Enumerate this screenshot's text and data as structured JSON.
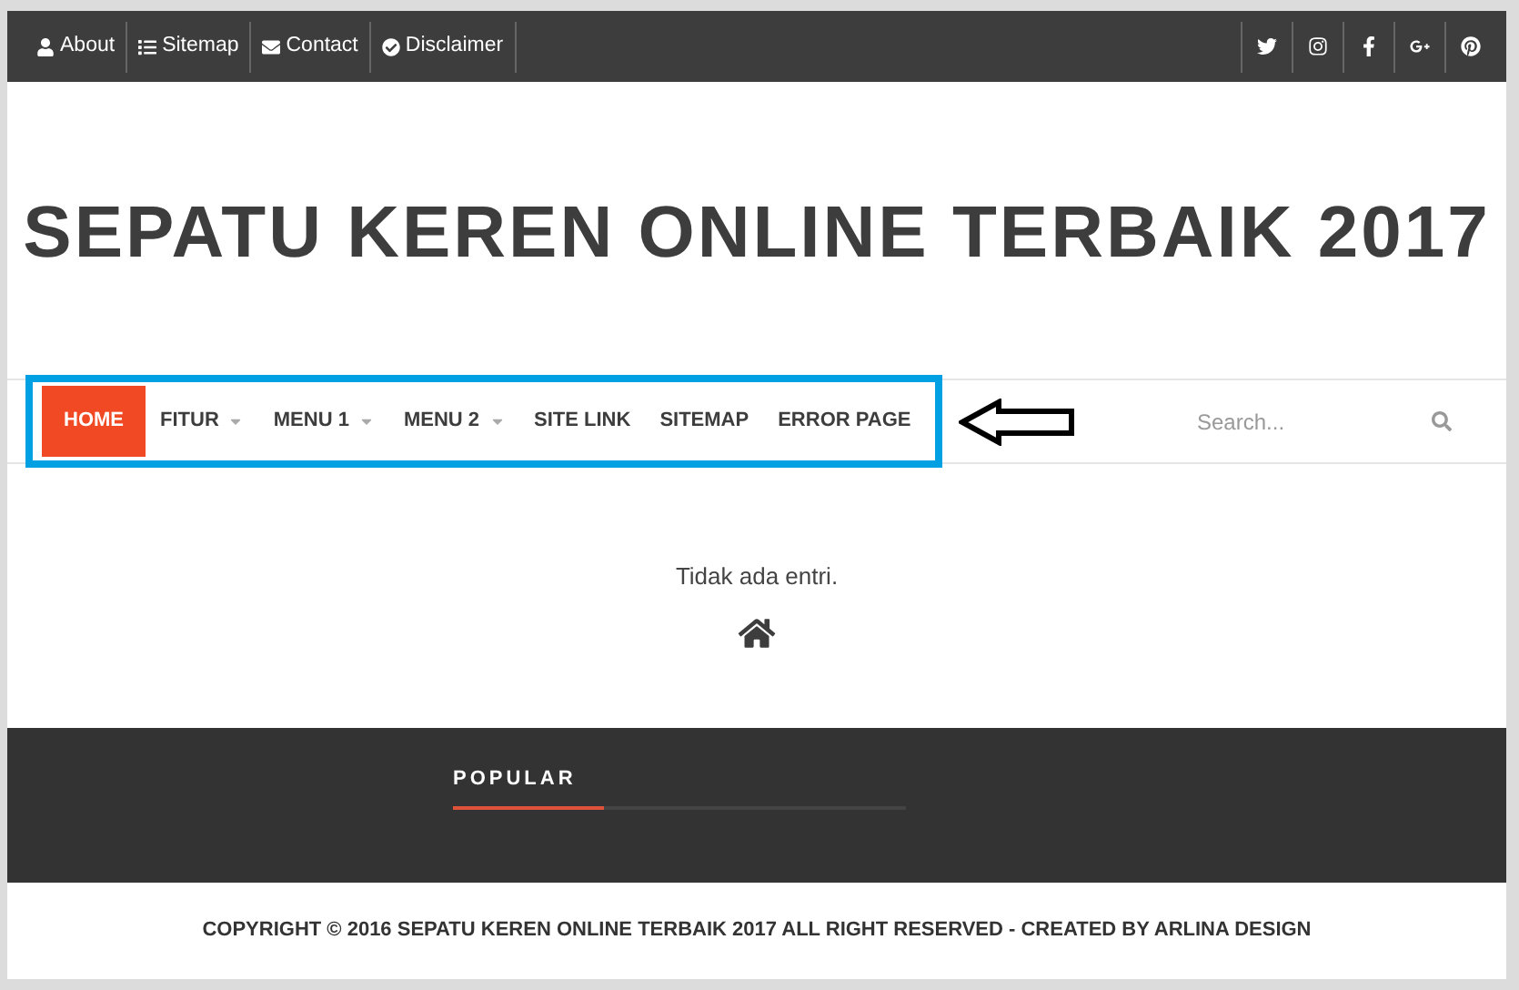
{
  "top_links": [
    {
      "label": "About"
    },
    {
      "label": "Sitemap"
    },
    {
      "label": "Contact"
    },
    {
      "label": "Disclaimer"
    }
  ],
  "site_title": "SEPATU KEREN ONLINE TERBAIK 2017",
  "nav": [
    {
      "label": "HOME",
      "selected": true,
      "has_dropdown": false
    },
    {
      "label": "FITUR",
      "selected": false,
      "has_dropdown": true
    },
    {
      "label": "MENU 1",
      "selected": false,
      "has_dropdown": true
    },
    {
      "label": "MENU 2",
      "selected": false,
      "has_dropdown": true
    },
    {
      "label": "SITE LINK",
      "selected": false,
      "has_dropdown": false
    },
    {
      "label": "SITEMAP",
      "selected": false,
      "has_dropdown": false
    },
    {
      "label": "ERROR PAGE",
      "selected": false,
      "has_dropdown": false
    }
  ],
  "search": {
    "placeholder": "Search..."
  },
  "content": {
    "message": "Tidak ada entri."
  },
  "footer": {
    "widget_title": "POPULAR",
    "copyright": "COPYRIGHT © 2016 SEPATU KEREN ONLINE TERBAIK 2017 ALL RIGHT RESERVED - CREATED BY ARLINA DESIGN"
  }
}
